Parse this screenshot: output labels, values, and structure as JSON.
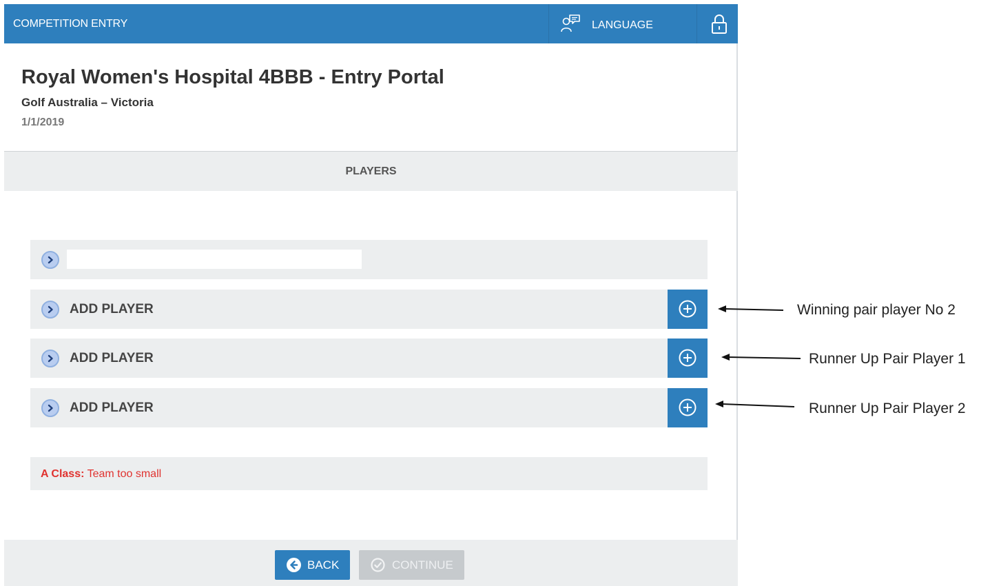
{
  "topbar": {
    "title": "COMPETITION ENTRY",
    "language_label": "LANGUAGE",
    "icons": [
      "language-icon",
      "lock-icon"
    ]
  },
  "header": {
    "title": "Royal Women's Hospital 4BBB - Entry Portal",
    "organisation": "Golf Australia – Victoria",
    "date": "1/1/2019"
  },
  "section": {
    "label": "PLAYERS"
  },
  "players": {
    "first_row_value": "",
    "rows": [
      {
        "label": "ADD PLAYER"
      },
      {
        "label": "ADD PLAYER"
      },
      {
        "label": "ADD PLAYER"
      }
    ]
  },
  "message": {
    "prefix": "A Class:",
    "text": "Team too small"
  },
  "footer": {
    "back_label": "BACK",
    "continue_label": "CONTINUE"
  },
  "annotations": [
    "Winning pair player No 2",
    "Runner Up Pair Player 1",
    "Runner Up Pair Player 2"
  ],
  "colors": {
    "primary": "#2e7fbd",
    "panel_gray": "#eceeef",
    "error": "#e0322f",
    "disabled": "#c6cacd"
  }
}
